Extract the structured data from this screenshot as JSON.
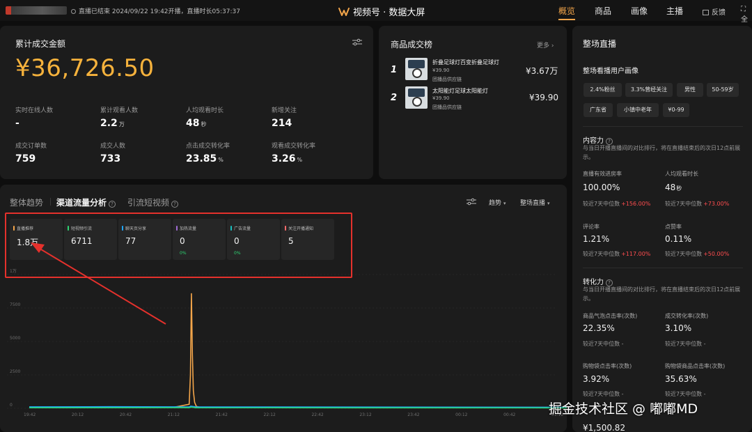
{
  "header": {
    "live_status": "直播已结束 2024/09/22 19:42开播，直播时长05:37:37",
    "brand": "视频号 · 数据大屏",
    "nav": [
      "概览",
      "商品",
      "画像",
      "主播"
    ],
    "active_nav": "概览",
    "feedback": "反馈",
    "fullscreen": "全"
  },
  "overview": {
    "title": "累计成交金额",
    "gmv": "¥36,726.50",
    "stats": [
      {
        "label": "实时在线人数",
        "value": "-",
        "unit": ""
      },
      {
        "label": "累计观看人数",
        "value": "2.2",
        "unit": "万"
      },
      {
        "label": "人均观看时长",
        "value": "48",
        "unit": "秒"
      },
      {
        "label": "新增关注",
        "value": "214",
        "unit": ""
      },
      {
        "label": "成交订单数",
        "value": "759",
        "unit": ""
      },
      {
        "label": "成交人数",
        "value": "733",
        "unit": ""
      },
      {
        "label": "点击成交转化率",
        "value": "23.85",
        "unit": "%"
      },
      {
        "label": "观看成交转化率",
        "value": "3.26",
        "unit": "%"
      }
    ]
  },
  "ranking": {
    "title": "商品成交榜",
    "more": "更多 ›",
    "items": [
      {
        "rank": "1",
        "name": "折叠足球灯百变折叠足球灯",
        "price": "¥39.90",
        "supplier": "团播品供应链",
        "sales": "¥3.67万"
      },
      {
        "rank": "2",
        "name": "太阳能灯足球太阳能灯",
        "price": "¥39.90",
        "supplier": "团播品供应链",
        "sales": "¥39.90"
      }
    ]
  },
  "trend": {
    "tabs": [
      "整体趋势",
      "渠道流量分析",
      "引流短视频"
    ],
    "active_tab": "渠道流量分析",
    "dropdowns": [
      "趋势",
      "整场直播"
    ],
    "channels": [
      {
        "label": "直播推荐",
        "value": "1.8万",
        "change": "",
        "color": "#f3a54a"
      },
      {
        "label": "短视频引流",
        "value": "6711",
        "change": "",
        "color": "#2ed573"
      },
      {
        "label": "聊天页分享",
        "value": "77",
        "change": "",
        "color": "#1ea7ff"
      },
      {
        "label": "加热流量",
        "value": "0",
        "change": "0%",
        "color": "#a06cd5"
      },
      {
        "label": "广告流量",
        "value": "0",
        "change": "0%",
        "color": "#19c2c2"
      },
      {
        "label": "关注开播通知",
        "value": "5",
        "change": "",
        "color": "#ff6b6b"
      }
    ]
  },
  "chart_data": {
    "type": "line",
    "x": [
      "19:42",
      "20:12",
      "20:42",
      "21:12",
      "21:42",
      "22:12",
      "22:42",
      "23:12",
      "23:42",
      "00:12",
      "00:42",
      "01:12"
    ],
    "yticks": [
      "0",
      "2500",
      "5000",
      "7500",
      "1万"
    ],
    "ylim": [
      0,
      10000
    ],
    "series": [
      {
        "name": "直播推荐",
        "color": "#f3a54a",
        "points": [
          [
            0,
            90
          ],
          [
            90,
            70
          ],
          [
            100,
            300
          ],
          [
            100.8,
            2500
          ],
          [
            101.4,
            8600
          ],
          [
            102,
            4000
          ],
          [
            102.6,
            1300
          ],
          [
            103.4,
            450
          ],
          [
            104.5,
            140
          ],
          [
            107,
            70
          ],
          [
            337,
            70
          ]
        ]
      },
      {
        "name": "短视频引流",
        "color": "#1ea7ff",
        "points": [
          [
            0,
            110
          ],
          [
            50,
            120
          ],
          [
            100,
            105
          ],
          [
            101,
            160
          ],
          [
            104,
            110
          ],
          [
            337,
            80
          ]
        ]
      },
      {
        "name": "聊天页分享",
        "color": "#2ed573",
        "points": [
          [
            0,
            40
          ],
          [
            100,
            45
          ],
          [
            101.5,
            90
          ],
          [
            104,
            40
          ],
          [
            337,
            30
          ]
        ]
      }
    ]
  },
  "audience": {
    "title": "整场直播",
    "portrait_title": "整场看播用户画像",
    "tags": [
      "2.4%粉丝",
      "3.3%曾经关注",
      "男性",
      "50-59岁",
      "广东省",
      "小镇中老年",
      "¥0-99"
    ]
  },
  "content_power": {
    "title": "内容力",
    "desc": "与当日开播直播间的对比排行，将在直播结束后的次日12点前展示。",
    "metrics": [
      {
        "label": "直播有效进房率",
        "value": "100.00%",
        "unit": "",
        "compare": "较近7天中位数",
        "delta": "+156.00%"
      },
      {
        "label": "人均观看时长",
        "value": "48",
        "unit": "秒",
        "compare": "较近7天中位数",
        "delta": "+73.00%"
      },
      {
        "label": "评论率",
        "value": "1.21%",
        "unit": "",
        "compare": "较近7天中位数",
        "delta": "+117.00%"
      },
      {
        "label": "点赞率",
        "value": "0.11%",
        "unit": "",
        "compare": "较近7天中位数",
        "delta": "+50.00%"
      }
    ]
  },
  "conversion_power": {
    "title": "转化力",
    "desc": "与当日开播直播间的对比排行，将在直播结束后的次日12点前展示。",
    "metrics": [
      {
        "label": "商品气泡点击率(次数)",
        "value": "22.35%",
        "compare": "较近7天中位数 -"
      },
      {
        "label": "成交转化率(次数)",
        "value": "3.10%",
        "compare": "较近7天中位数 -"
      },
      {
        "label": "购物袋点击率(次数)",
        "value": "3.92%",
        "compare": "较近7天中位数 -"
      },
      {
        "label": "购物袋商品点击率(次数)",
        "value": "35.63%",
        "compare": "较近7天中位数 -"
      }
    ],
    "cut_value": "¥1,500.82"
  },
  "watermark": "掘金技术社区 @ 嘟嘟MD",
  "colors": {
    "accent": "#f3a54a",
    "highlight": "#e5312c",
    "up": "#ff4d4f",
    "positive": "#2ed573"
  }
}
